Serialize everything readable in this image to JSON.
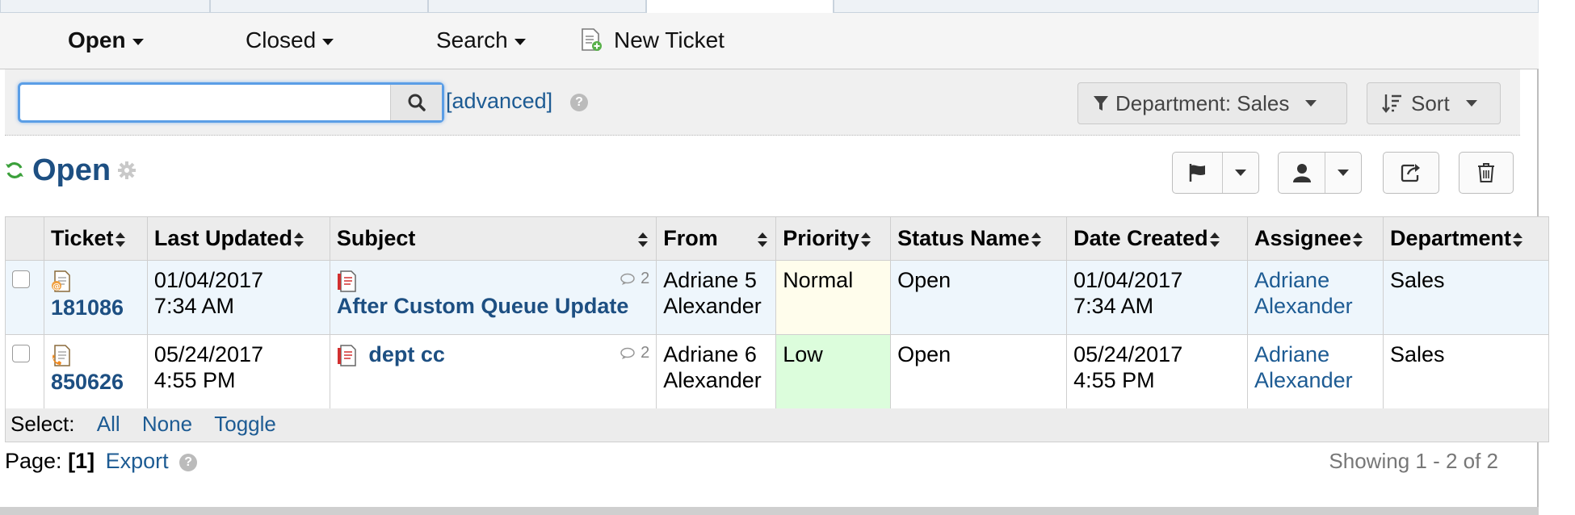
{
  "subnav": {
    "open_label": "Open",
    "closed_label": "Closed",
    "search_label": "Search",
    "new_ticket_label": "New Ticket"
  },
  "search": {
    "value": "",
    "placeholder": "",
    "advanced_label": "[advanced]",
    "department_filter": "Department: Sales",
    "sort_label": "Sort"
  },
  "queue": {
    "title": "Open"
  },
  "table": {
    "headers": [
      "Ticket",
      "Last Updated",
      "Subject",
      "From",
      "Priority",
      "Status Name",
      "Date Created",
      "Assignee",
      "Department"
    ],
    "rows": [
      {
        "ticket": "181086",
        "last_updated_date": "01/04/2017",
        "last_updated_time": "7:34 AM",
        "subject": "After Custom Queue Update",
        "thread_count": "2",
        "from_first": "Adriane",
        "from_count": "5",
        "from_last": "Alexander",
        "priority": "Normal",
        "status": "Open",
        "created_date": "01/04/2017",
        "created_time": "7:34 AM",
        "assignee_first": "Adriane",
        "assignee_last": "Alexander",
        "department": "Sales"
      },
      {
        "ticket": "850626",
        "last_updated_date": "05/24/2017",
        "last_updated_time": "4:55 PM",
        "subject": "dept cc",
        "thread_count": "2",
        "from_first": "Adriane",
        "from_count": "6",
        "from_last": "Alexander",
        "priority": "Low",
        "status": "Open",
        "created_date": "05/24/2017",
        "created_time": "4:55 PM",
        "assignee_first": "Adriane",
        "assignee_last": "Alexander",
        "department": "Sales"
      }
    ]
  },
  "select_bar": {
    "label": "Select:",
    "all": "All",
    "none": "None",
    "toggle": "Toggle"
  },
  "footer": {
    "page_label": "Page:",
    "page_value": "[1]",
    "export_label": "Export",
    "showing": "Showing 1 - 2 of 2"
  },
  "colors": {
    "link": "#1d5b93",
    "title": "#1d4f82",
    "priority_normal_bg": "#fffdec",
    "priority_low_bg": "#dcfddc",
    "row_highlight": "#eef6fc"
  }
}
